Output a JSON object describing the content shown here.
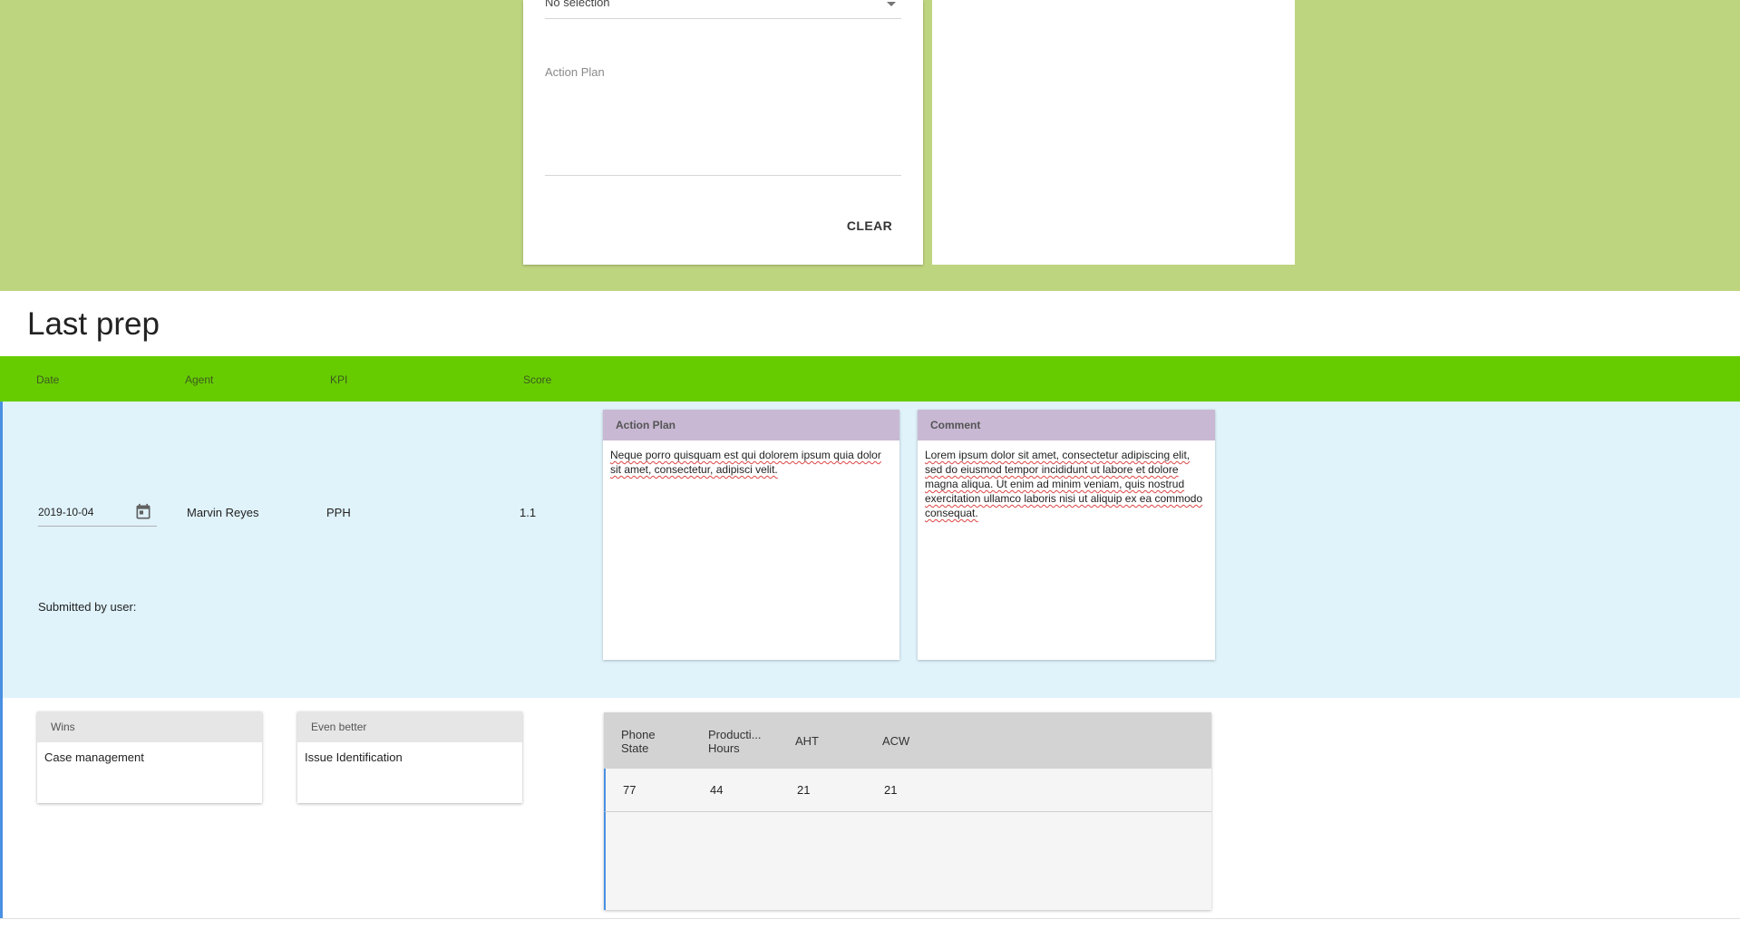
{
  "form": {
    "select_value": "No selection",
    "action_plan_label": "Action Plan",
    "clear_label": "CLEAR"
  },
  "section_title": "Last prep",
  "columns": {
    "date": "Date",
    "agent": "Agent",
    "kpi": "KPI",
    "score": "Score"
  },
  "record": {
    "date": "2019-10-04",
    "agent": "Marvin Reyes",
    "kpi": "PPH",
    "score": "1.1",
    "submitted_by": "Submitted by user:",
    "action_plan": {
      "title": "Action Plan",
      "text": "Neque porro quisquam est qui dolorem ipsum quia dolor sit amet, consectetur, adipisci velit."
    },
    "comment": {
      "title": "Comment",
      "text": "Lorem ipsum dolor sit amet, consectetur adipiscing elit, sed do eiusmod tempor incididunt ut labore et dolore magna aliqua. Ut enim ad minim veniam, quis nostrud exercitation ullamco laboris nisi ut aliquip ex ea commodo consequat."
    }
  },
  "wins": {
    "title": "Wins",
    "value": "Case management"
  },
  "even_better": {
    "title": "Even better",
    "value": "Issue Identification"
  },
  "stats": {
    "headers": [
      "Phone State",
      "Producti... Hours",
      "AHT",
      "ACW"
    ],
    "values": [
      "77",
      "44",
      "21",
      "21"
    ]
  },
  "icons": {
    "calendar": "calendar-icon",
    "dropdown": "arrow-drop-down-icon"
  },
  "colors": {
    "top_band": "#bed57f",
    "header_bar": "#66cc00",
    "row_highlight": "#e0f3fb",
    "note_header": "#c8b8d3",
    "accent": "#4a90e2"
  }
}
